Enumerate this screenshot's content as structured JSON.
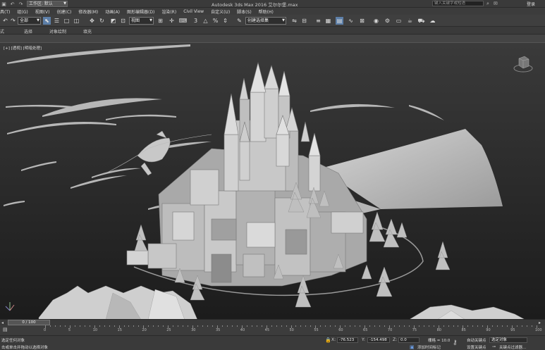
{
  "titlebar": {
    "workspace_label": "工作区: 默认",
    "app_title": "Autodesk 3ds Max 2016    艾尔尔堡.max",
    "help_search_placeholder": "键入关键字或短语",
    "login": "登录"
  },
  "menu": [
    "具(T)",
    "组(G)",
    "视图(V)",
    "创建(C)",
    "修改器(M)",
    "动画(A)",
    "图形编辑器(D)",
    "渲染(R)",
    "Civil View",
    "自定义(U)",
    "脚本(S)",
    "帮助(H)"
  ],
  "toolbar": {
    "selection_filter": "全部",
    "ref_coord": "视图",
    "named_selection": "创建选择集"
  },
  "ribbon_tabs": [
    "式",
    "选择",
    "对象绘制",
    "填充"
  ],
  "viewport": {
    "label": "[+] [透视] [明暗处理]"
  },
  "timeslider": {
    "frame_display": "0 / 100"
  },
  "trackbar": {
    "ticks": [
      "0",
      "5",
      "10",
      "15",
      "20",
      "25",
      "30",
      "35",
      "40",
      "45",
      "50",
      "55",
      "60",
      "65",
      "70",
      "75",
      "80",
      "85",
      "90",
      "95",
      "100"
    ]
  },
  "status": {
    "selection_msg": "选定任何对象",
    "prompt_msg": "击或单击并拖动以选择对象",
    "x_label": "X:",
    "x_value": "-76.523",
    "y_label": "Y:",
    "y_value": "-154.498",
    "z_label": "Z:",
    "z_value": "0.0",
    "grid": "栅格 = 10.0",
    "add_time_tag": "添加时间标记",
    "auto_key": "自动关键点",
    "set_key": "设置关键点",
    "selected_object": "选定对象",
    "key_filters": "关键点过滤器..."
  }
}
